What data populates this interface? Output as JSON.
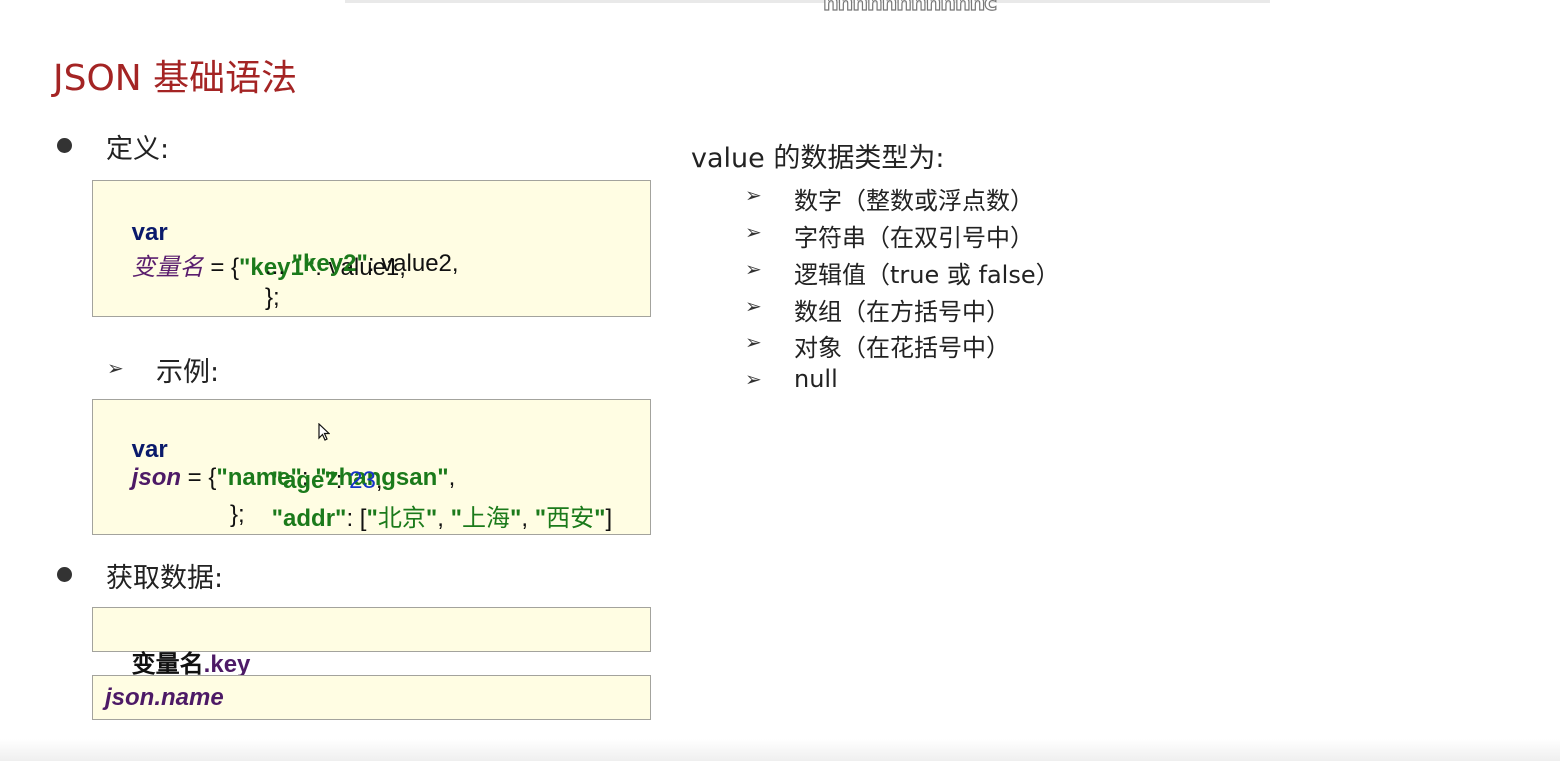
{
  "watermark": "nnnnnnnnnnnc",
  "slide": {
    "title": "JSON 基础语法",
    "definition_heading": "定义:",
    "example_heading": "示例:",
    "getdata_heading": "获取数据:"
  },
  "definition_code": {
    "var": "var",
    "varname": "变量名",
    "eq_open": " = {",
    "key1": "\"key1\"",
    "val1": ": value1,",
    "key2": "\"key2\"",
    "val2": ": value2,",
    "dots": "...",
    "close": "};"
  },
  "example_code": {
    "var": "var",
    "name": "json",
    "eq_open": " = {",
    "k_name": "\"name\"",
    "colon1": ": ",
    "v_name": "\"zhangsan\"",
    "comma1": ",",
    "k_age": "\"age\"",
    "colon2": ": ",
    "v_age": "23",
    "comma2": ",",
    "k_addr": "\"addr\"",
    "colon3": ": [",
    "q": "\"",
    "city1": "北京",
    "city2": "上海",
    "city3": "西安",
    "sep": ", ",
    "bracket_close": "]",
    "close": "};"
  },
  "access1": {
    "varname": "变量名",
    "prop": ".key"
  },
  "access2": {
    "text": "json.name"
  },
  "value_types": {
    "heading": "value 的数据类型为:",
    "items": [
      "数字（整数或浮点数）",
      "字符串（在双引号中）",
      "逻辑值（true 或 false）",
      "数组（在方括号中）",
      "对象（在花括号中）",
      "null"
    ]
  },
  "arrow_glyph": "➢"
}
